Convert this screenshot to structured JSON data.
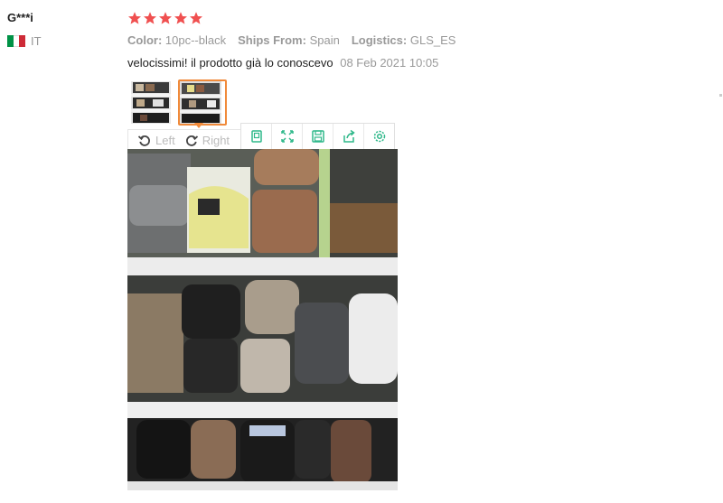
{
  "reviewer": {
    "name": "G***i",
    "country": "IT",
    "flag_colors": [
      "#009246",
      "#ffffff",
      "#ce2b37"
    ]
  },
  "rating": {
    "stars": 5,
    "max": 5,
    "color": "#f05050"
  },
  "attributes": {
    "color_label": "Color:",
    "color_value": "10pc--black",
    "ships_label": "Ships From:",
    "ships_value": "Spain",
    "logistics_label": "Logistics:",
    "logistics_value": "GLS_ES"
  },
  "review": {
    "text": "velocissimi! il prodotto già lo conoscevo",
    "date": "08 Feb 2021 10:05"
  },
  "viewer": {
    "rotate_left_label": "Left",
    "rotate_right_label": "Right",
    "selected_thumbnail": 2,
    "toolbar_icons": [
      "thumbnail-icon",
      "fullscreen-icon",
      "save-icon",
      "share-icon",
      "settings-icon"
    ],
    "accent_color": "#2fb88a"
  }
}
